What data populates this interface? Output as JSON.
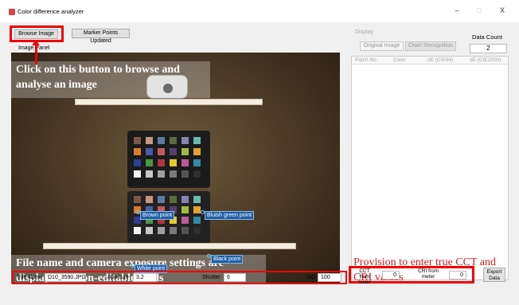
{
  "window": {
    "title": "Color difference analyzer",
    "minimize": "–",
    "maximize": "□",
    "close": "X"
  },
  "toolbar": {
    "browse_label": "Browse Image",
    "marker_label": "Marker Points Updated"
  },
  "image_panel": {
    "label": "Image Panel",
    "annotation_browse": "Click on this button to browse and analyse an image",
    "annotation_file": "File name and camera exposure settings are displayed in non-editable fields",
    "markers": {
      "brown": "Brown point",
      "bluish_green": "Bluish green point",
      "black": "Black point",
      "white": "White point"
    },
    "patch_colors": [
      "#7a5a45",
      "#c69783",
      "#5d7aa3",
      "#5a6b3f",
      "#8583b3",
      "#67bcae",
      "#dc7b2b",
      "#4a5ba8",
      "#c05a62",
      "#5c3c6c",
      "#9fbc40",
      "#e3a32e",
      "#2e3e8f",
      "#4b9848",
      "#b2343a",
      "#e8cb2a",
      "#bc5a97",
      "#2f8aa4",
      "#f2f2f2",
      "#c8c8c8",
      "#a0a0a0",
      "#7a7a7a",
      "#545454",
      "#2e2e2e"
    ]
  },
  "display": {
    "label": "Display",
    "original_image": "Original Image",
    "chart_recognition": "Chart Recognition"
  },
  "data_count": {
    "label": "Data Count",
    "value": "2"
  },
  "table": {
    "headers": [
      "Patch No.",
      "Color",
      "dE (CIE94)",
      "dE (CIE2000)"
    ]
  },
  "provision_note": "Provision to enter true CCT and CRI values",
  "footer": {
    "file_name_label": "File Name",
    "file_name_value": "D10_3590.JPG",
    "aperture_label": "Aperture",
    "aperture_value": "3.2",
    "shutter_label": "Shutter",
    "shutter_value": "6",
    "iso_label": "ISO",
    "iso_value": "100",
    "cct_label": "CCT from meter",
    "cct_value": "0",
    "cri_label": "CRI from meter",
    "cri_value": "0",
    "export_label": "Export Data"
  }
}
